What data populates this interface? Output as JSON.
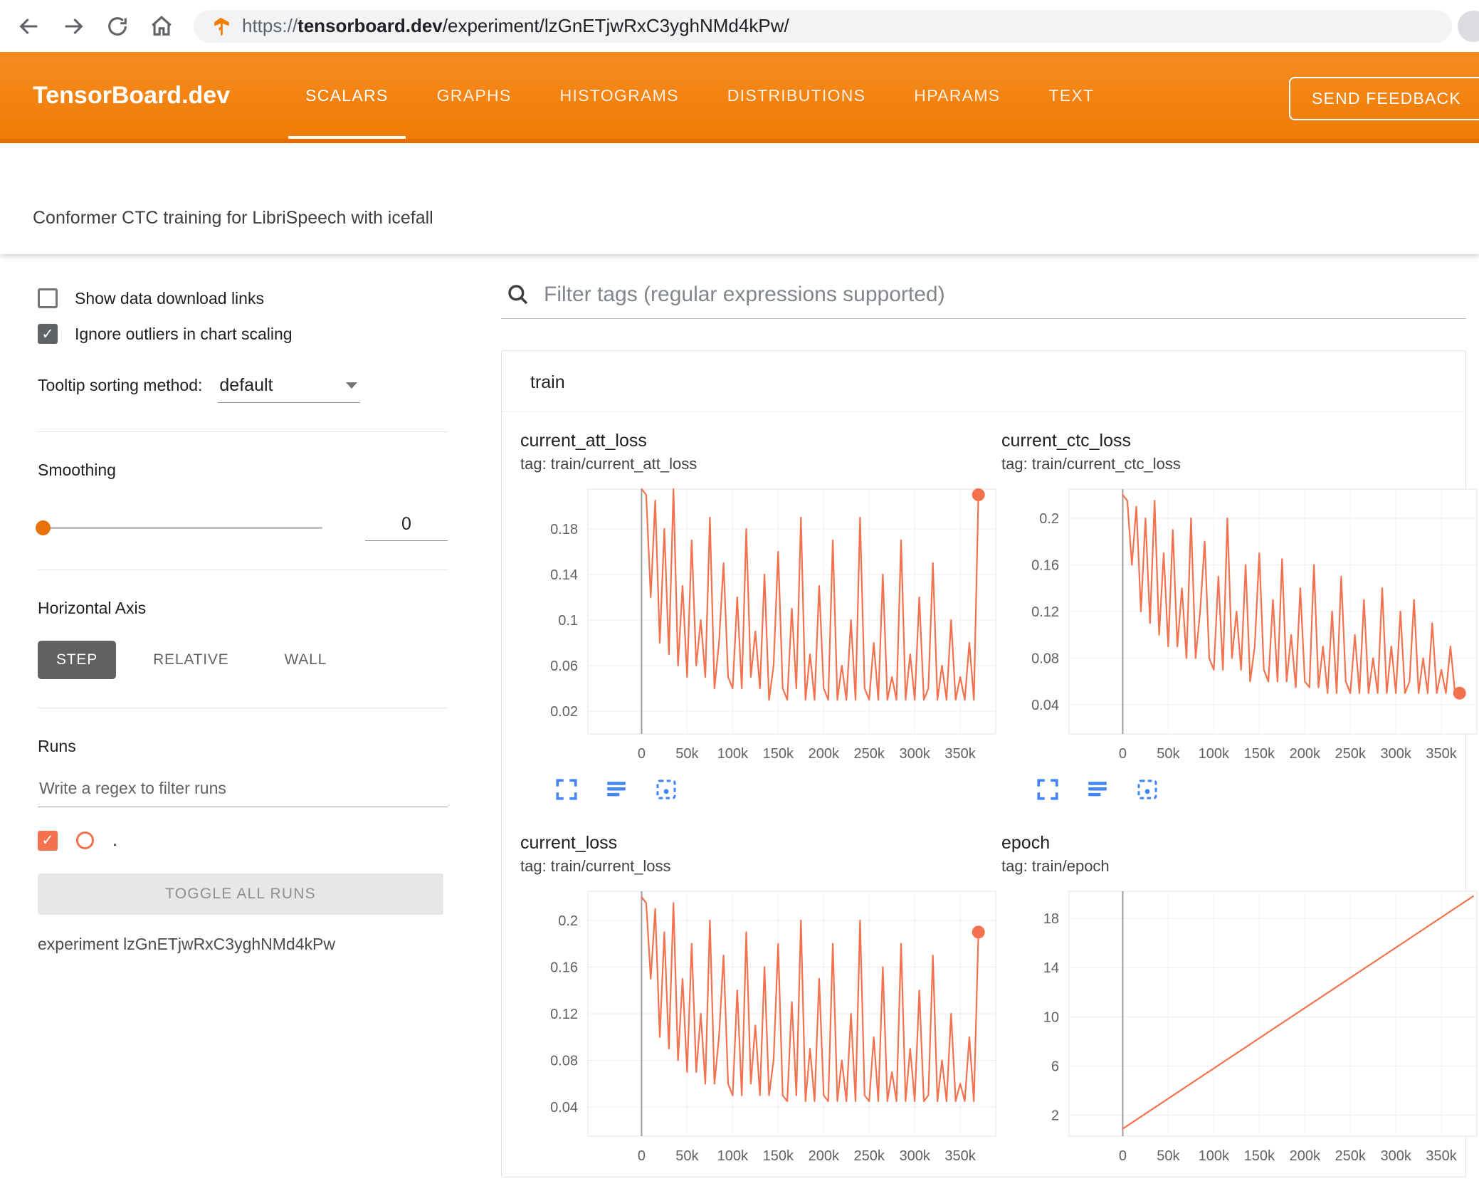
{
  "browser": {
    "url_scheme": "https://",
    "url_domain": "tensorboard.dev",
    "url_path": "/experiment/lzGnETjwRxC3yghNMd4kPw/"
  },
  "header": {
    "brand": "TensorBoard.dev",
    "tabs": [
      "SCALARS",
      "GRAPHS",
      "HISTOGRAMS",
      "DISTRIBUTIONS",
      "HPARAMS",
      "TEXT"
    ],
    "active_tab": "SCALARS",
    "feedback": "SEND FEEDBACK"
  },
  "subtitle": "Conformer CTC training for LibriSpeech with icefall",
  "sidebar": {
    "show_download_label": "Show data download links",
    "ignore_outliers_label": "Ignore outliers in chart scaling",
    "tooltip_label": "Tooltip sorting method:",
    "tooltip_value": "default",
    "smoothing_label": "Smoothing",
    "smoothing_value": "0",
    "horizontal_axis_label": "Horizontal Axis",
    "axis_step": "STEP",
    "axis_relative": "RELATIVE",
    "axis_wall": "WALL",
    "runs_label": "Runs",
    "runs_placeholder": "Write a regex to filter runs",
    "run_name": ".",
    "toggle_all_label": "TOGGLE ALL RUNS",
    "experiment_label": "experiment lzGnETjwRxC3yghNMd4kPw"
  },
  "main": {
    "filter_placeholder": "Filter tags (regular expressions supported)",
    "section_title": "train"
  },
  "colors": {
    "accent": "#f57c00",
    "series": "#f4714e",
    "icon_blue": "#4285f4",
    "grid": "#ececec",
    "axis_text": "#616161",
    "zero_line": "#9e9e9e"
  },
  "chart_data": [
    {
      "type": "line",
      "title": "current_att_loss",
      "tag": "tag: train/current_att_loss",
      "xlim": [
        -59000,
        389000
      ],
      "ylim": [
        0,
        0.215
      ],
      "yticks": [
        0.02,
        0.06,
        0.1,
        0.14,
        0.18
      ],
      "xticks": [
        0,
        50000,
        100000,
        150000,
        200000,
        250000,
        300000,
        350000
      ],
      "xtick_labels": [
        "0",
        "50k",
        "100k",
        "150k",
        "200k",
        "250k",
        "300k",
        "350k"
      ],
      "x_start": 0,
      "x_step": 5000,
      "end_dot": true,
      "values": [
        0.215,
        0.21,
        0.12,
        0.205,
        0.08,
        0.18,
        0.07,
        0.215,
        0.06,
        0.13,
        0.05,
        0.17,
        0.06,
        0.1,
        0.05,
        0.19,
        0.04,
        0.08,
        0.15,
        0.05,
        0.04,
        0.12,
        0.04,
        0.18,
        0.05,
        0.09,
        0.04,
        0.14,
        0.03,
        0.06,
        0.16,
        0.04,
        0.03,
        0.11,
        0.04,
        0.19,
        0.03,
        0.07,
        0.03,
        0.13,
        0.04,
        0.03,
        0.17,
        0.03,
        0.06,
        0.03,
        0.1,
        0.03,
        0.19,
        0.04,
        0.03,
        0.08,
        0.03,
        0.14,
        0.03,
        0.05,
        0.03,
        0.17,
        0.03,
        0.07,
        0.03,
        0.12,
        0.03,
        0.04,
        0.15,
        0.03,
        0.06,
        0.03,
        0.1,
        0.03,
        0.05,
        0.03,
        0.08,
        0.03,
        0.21
      ]
    },
    {
      "type": "line",
      "title": "current_ctc_loss",
      "tag": "tag: train/current_ctc_loss",
      "xlim": [
        -59000,
        389000
      ],
      "ylim": [
        0.015,
        0.225
      ],
      "yticks": [
        0.04,
        0.08,
        0.12,
        0.16,
        0.2
      ],
      "xticks": [
        0,
        50000,
        100000,
        150000,
        200000,
        250000,
        300000,
        350000
      ],
      "xtick_labels": [
        "0",
        "50k",
        "100k",
        "150k",
        "200k",
        "250k",
        "300k",
        "350k"
      ],
      "x_start": 0,
      "x_step": 5000,
      "end_dot": true,
      "values": [
        0.22,
        0.215,
        0.16,
        0.21,
        0.12,
        0.2,
        0.11,
        0.215,
        0.1,
        0.17,
        0.09,
        0.19,
        0.09,
        0.14,
        0.08,
        0.2,
        0.08,
        0.12,
        0.18,
        0.08,
        0.07,
        0.15,
        0.07,
        0.2,
        0.08,
        0.12,
        0.07,
        0.16,
        0.06,
        0.09,
        0.17,
        0.07,
        0.06,
        0.13,
        0.06,
        0.165,
        0.06,
        0.1,
        0.055,
        0.14,
        0.06,
        0.055,
        0.16,
        0.055,
        0.09,
        0.05,
        0.12,
        0.05,
        0.15,
        0.06,
        0.05,
        0.1,
        0.05,
        0.13,
        0.05,
        0.08,
        0.05,
        0.14,
        0.05,
        0.09,
        0.05,
        0.12,
        0.05,
        0.06,
        0.13,
        0.05,
        0.08,
        0.05,
        0.11,
        0.05,
        0.07,
        0.05,
        0.09,
        0.05,
        0.05
      ]
    },
    {
      "type": "line",
      "title": "current_loss",
      "tag": "tag: train/current_loss",
      "xlim": [
        -59000,
        389000
      ],
      "ylim": [
        0.015,
        0.225
      ],
      "yticks": [
        0.04,
        0.08,
        0.12,
        0.16,
        0.2
      ],
      "xticks": [
        0,
        50000,
        100000,
        150000,
        200000,
        250000,
        300000,
        350000
      ],
      "xtick_labels": [
        "0",
        "50k",
        "100k",
        "150k",
        "200k",
        "250k",
        "300k",
        "350k"
      ],
      "x_start": 0,
      "x_step": 5000,
      "end_dot": true,
      "values": [
        0.22,
        0.215,
        0.15,
        0.21,
        0.1,
        0.19,
        0.09,
        0.215,
        0.08,
        0.15,
        0.07,
        0.18,
        0.07,
        0.12,
        0.06,
        0.2,
        0.06,
        0.1,
        0.17,
        0.06,
        0.05,
        0.14,
        0.05,
        0.19,
        0.06,
        0.11,
        0.05,
        0.16,
        0.05,
        0.08,
        0.18,
        0.05,
        0.045,
        0.13,
        0.05,
        0.2,
        0.045,
        0.09,
        0.045,
        0.15,
        0.05,
        0.045,
        0.18,
        0.045,
        0.08,
        0.045,
        0.12,
        0.045,
        0.2,
        0.05,
        0.045,
        0.1,
        0.045,
        0.16,
        0.045,
        0.07,
        0.045,
        0.18,
        0.045,
        0.09,
        0.045,
        0.14,
        0.045,
        0.05,
        0.17,
        0.045,
        0.08,
        0.045,
        0.12,
        0.045,
        0.06,
        0.045,
        0.1,
        0.045,
        0.19
      ]
    },
    {
      "type": "line",
      "title": "epoch",
      "tag": "tag: train/epoch",
      "xlim": [
        -59000,
        389000
      ],
      "ylim": [
        0.3,
        20.2
      ],
      "yticks": [
        2,
        6,
        10,
        14,
        18
      ],
      "xticks": [
        0,
        50000,
        100000,
        150000,
        200000,
        250000,
        300000,
        350000
      ],
      "xtick_labels": [
        "0",
        "50k",
        "100k",
        "150k",
        "200k",
        "250k",
        "300k",
        "350k"
      ],
      "x": [
        0,
        385000
      ],
      "end_dot": false,
      "values": [
        0.9,
        19.8
      ]
    }
  ]
}
